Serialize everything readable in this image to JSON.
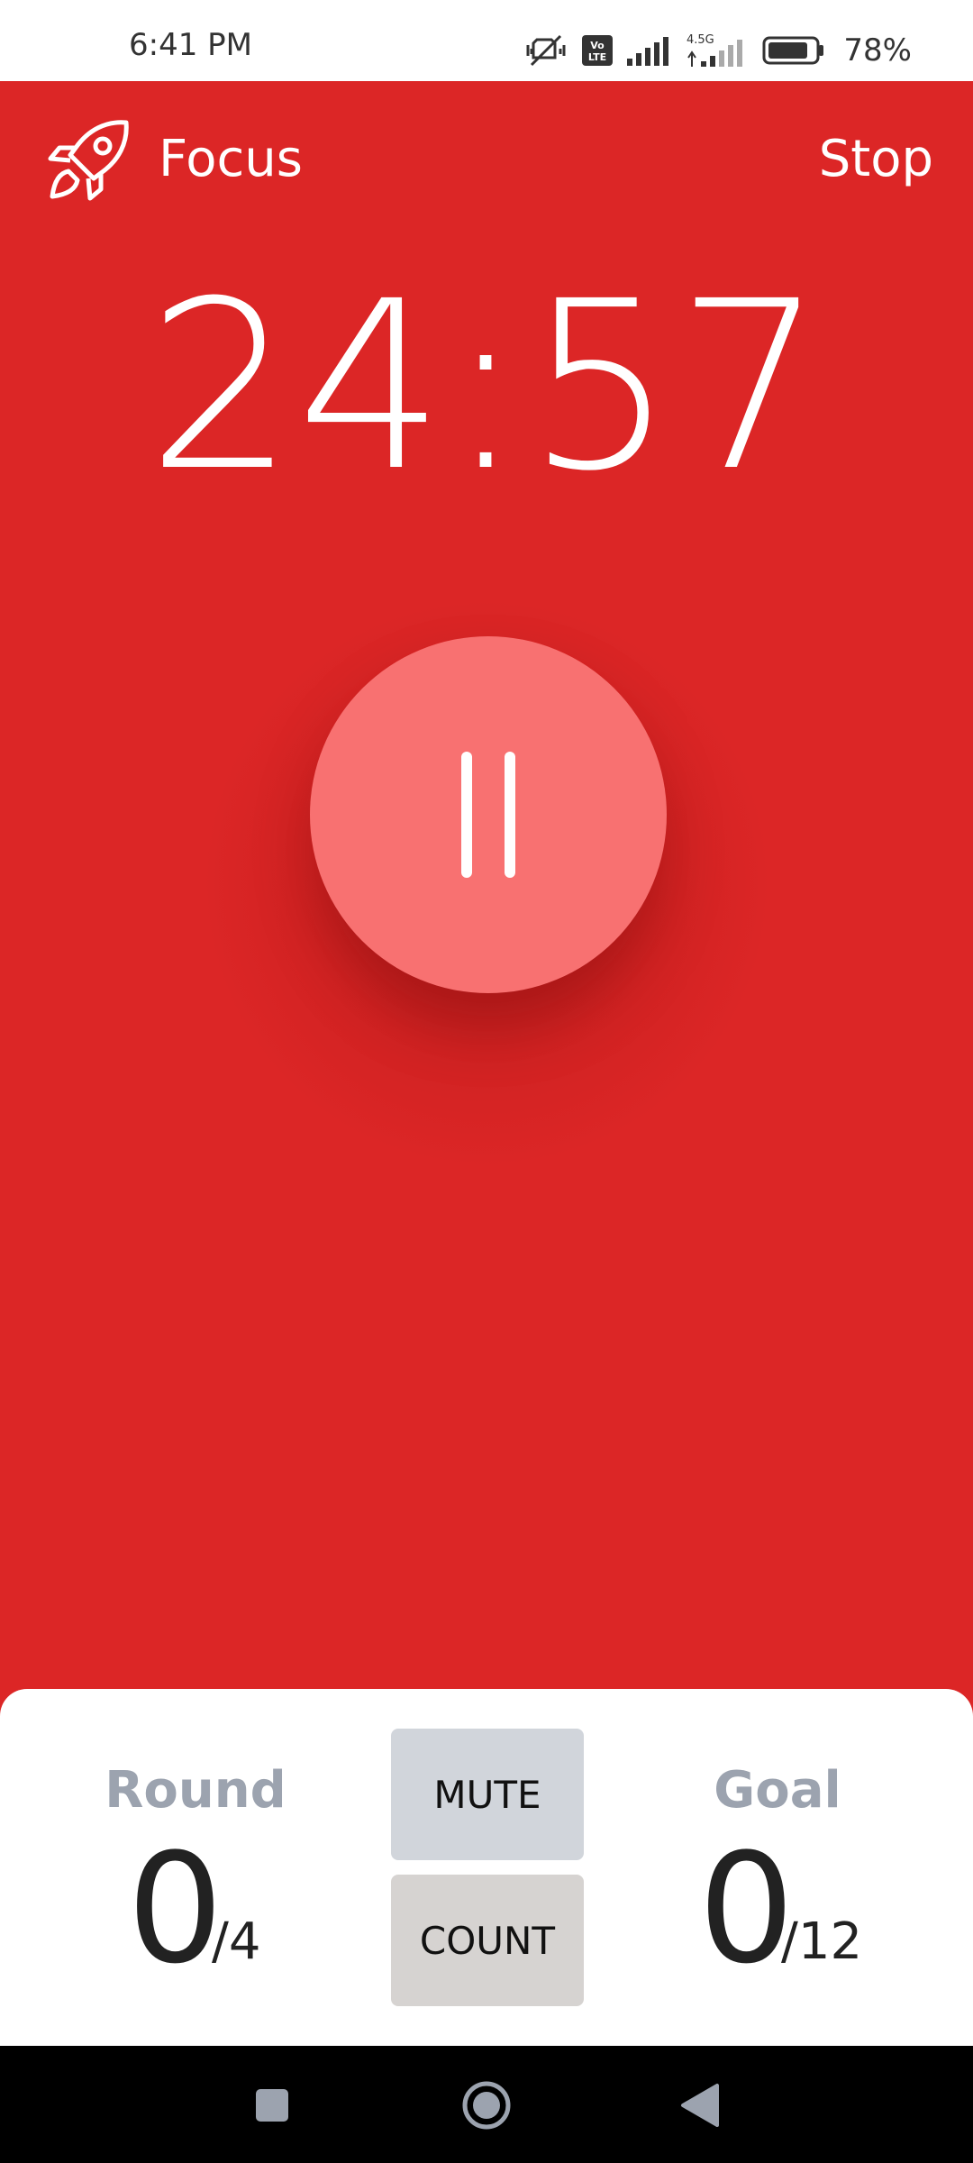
{
  "status_bar": {
    "time": "6:41 PM",
    "battery": "78%",
    "icons": [
      "mute-vibrate-icon",
      "volte-icon",
      "signal-icon",
      "signal-4-5g-icon",
      "battery-icon"
    ],
    "network_label": "4.5G"
  },
  "header": {
    "mode_icon": "rocket-icon",
    "mode_title": "Focus",
    "stop_label": "Stop"
  },
  "timer": {
    "remaining": "24:57"
  },
  "controls": {
    "pause_icon": "pause-icon"
  },
  "stats": {
    "round": {
      "label": "Round",
      "value": "0",
      "total": "/4"
    },
    "goal": {
      "label": "Goal",
      "value": "0",
      "total": "/12"
    }
  },
  "buttons": {
    "mute_label": "MUTE",
    "count_label": "COUNT"
  },
  "nav": {
    "recents_icon": "square-icon",
    "home_icon": "circle-icon",
    "back_icon": "triangle-back-icon"
  },
  "colors": {
    "background": "#dc2626",
    "pause_button": "#f87171",
    "stat_label": "#9ca3af",
    "mute_button": "#d1d5db",
    "count_button": "#d6d3d1"
  }
}
